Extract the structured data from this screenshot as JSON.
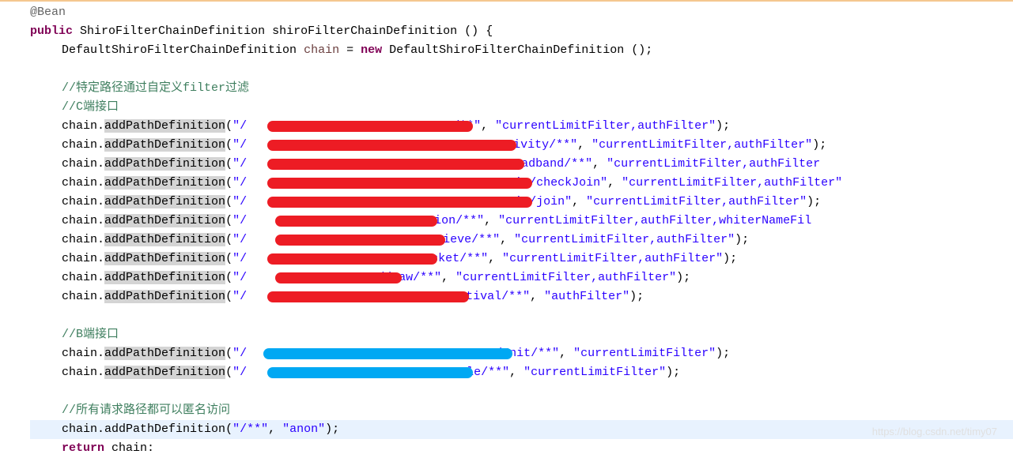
{
  "annotation": "@Bean",
  "sig": {
    "public": "public",
    "retType": "ShiroFilterChainDefinition",
    "methodName": "shiroFilterChainDefinition",
    "parens": "()",
    "brace": "{"
  },
  "decl": {
    "type1": "DefaultShiroFilterChainDefinition",
    "var": "chain",
    "eq": "=",
    "new": "new",
    "type2": "DefaultShiroFilterChainDefinition",
    "ctor": "();"
  },
  "comments": {
    "c1": "//特定路径通过自定义filter过滤",
    "c2": "//C端接口",
    "c3": "//B端接口",
    "c4": "//所有请求路径都可以匿名访问"
  },
  "lines": {
    "l1": {
      "obj": "chain",
      "dot": ".",
      "m": "addPathDefinition",
      "lp": "(",
      "s1": "\"/",
      "s1b": "/**\"",
      "cm": ", ",
      "s2": "\"currentLimitFilter,authFilter\"",
      "rp": ");"
    },
    "l2": {
      "obj": "chain",
      "dot": ".",
      "m": "addPathDefinition",
      "lp": "(",
      "s1": "\"/",
      "s1b": "Activity/**\"",
      "cm": ", ",
      "s2": "\"currentLimitFilter,authFilter\"",
      "rp": ");"
    },
    "l3": {
      "obj": "chain",
      "dot": ".",
      "m": "addPathDefinition",
      "lp": "(",
      "s1": "\"/",
      "s1b": "Broadband/**\"",
      "cm": ", ",
      "s2": "\"currentLimitFilter,authFilter",
      "rp": ""
    },
    "l4": {
      "obj": "chain",
      "dot": ".",
      "m": "addPathDefinition",
      "lp": "(",
      "s1": "\"/",
      "s1b": "Vip/checkJoin\"",
      "cm": ", ",
      "s2": "\"currentLimitFilter,authFilter\"",
      "rp": ""
    },
    "l5": {
      "obj": "chain",
      "dot": ".",
      "m": "addPathDefinition",
      "lp": "(",
      "s1": "\"/",
      "s1b": "Vip/join\"",
      "cm": ", ",
      "s2": "\"currentLimitFilter,authFilter\"",
      "rp": ");"
    },
    "l6": {
      "obj": "chain",
      "dot": ".",
      "m": "addPathDefinition",
      "lp": "(",
      "s1": "\"/",
      "s1b": "action/**\"",
      "cm": ", ",
      "s2": "\"currentLimitFilter,authFilter,whiterNameFil",
      "rp": ""
    },
    "l7": {
      "obj": "chain",
      "dot": ".",
      "m": "addPathDefinition",
      "lp": "(",
      "s1": "\"/",
      "s1b": "trieve/**\"",
      "cm": ", ",
      "s2": "\"currentLimitFilter,authFilter\"",
      "rp": ");"
    },
    "l8": {
      "obj": "chain",
      "dot": ".",
      "m": "addPathDefinition",
      "lp": "(",
      "s1": "\"/",
      "s1b": "Pocket/**\"",
      "cm": ", ",
      "s2": "\"currentLimitFilter,authFilter\"",
      "rp": ");"
    },
    "l9": {
      "obj": "chain",
      "dot": ".",
      "m": "addPathDefinition",
      "lp": "(",
      "s1": "\"/",
      "s1b": "/draw/**\"",
      "cm": ", ",
      "s2": "\"currentLimitFilter,authFilter\"",
      "rp": ");"
    },
    "l10": {
      "obj": "chain",
      "dot": ".",
      "m": "addPathDefinition",
      "lp": "(",
      "s1": "\"/",
      "s1b": "Festival/**\"",
      "cm": ", ",
      "s2": "\"authFilter\"",
      "rp": ");"
    },
    "l11": {
      "obj": "chain",
      "dot": ".",
      "m": "addPathDefinition",
      "lp": "(",
      "s1": "\"/",
      "s1b": "rdInit/**\"",
      "cm": ", ",
      "s2": "\"currentLimitFilter\"",
      "rp": ");"
    },
    "l12": {
      "obj": "chain",
      "dot": ".",
      "m": "addPathDefinition",
      "lp": "(",
      "s1": "\"/",
      "s1b": "Rule/**\"",
      "cm": ", ",
      "s2": "\"currentLimitFilter\"",
      "rp": ");"
    },
    "l13": {
      "obj": "chain",
      "dot": ".",
      "m": "addPathDefinition",
      "lp": "(",
      "s1": "\"/**\"",
      "cm": ", ",
      "s2": "\"anon\"",
      "rp": ");"
    }
  },
  "ret": {
    "kw": "return",
    "sp": " ",
    "v": "chain",
    "sc": ":"
  },
  "watermark": "https://blog.csdn.net/timy07"
}
